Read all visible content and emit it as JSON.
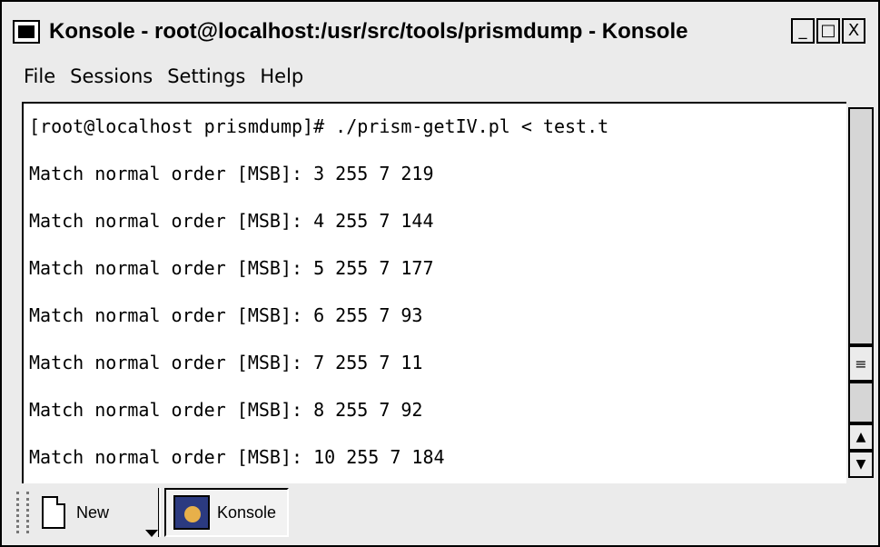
{
  "window": {
    "title": "Konsole - root@localhost:/usr/src/tools/prismdump - Konsole",
    "controls": {
      "minimize": "_",
      "maximize": "□",
      "close": "X"
    }
  },
  "menubar": {
    "items": [
      {
        "label": "File"
      },
      {
        "label": "Sessions"
      },
      {
        "label": "Settings"
      },
      {
        "label": "Help"
      }
    ]
  },
  "terminal": {
    "lines": [
      "[root@localhost prismdump]# ./prism-getIV.pl < test.t",
      "Match normal order [MSB]: 3 255 7 219",
      "Match normal order [MSB]: 4 255 7 144",
      "Match normal order [MSB]: 5 255 7 177",
      "Match normal order [MSB]: 6 255 7 93",
      "Match normal order [MSB]: 7 255 7 11",
      "Match normal order [MSB]: 8 255 7 92",
      "Match normal order [MSB]: 10 255 7 184"
    ]
  },
  "scrollbar": {
    "thumb_glyph": "≡",
    "up_glyph": "▲",
    "down_glyph": "▼"
  },
  "tabs": {
    "new_label": "New",
    "session_label": "Konsole"
  },
  "icons": {
    "app": "konsole-window-icon",
    "new": "new-document-icon",
    "session": "konsole-session-icon"
  }
}
